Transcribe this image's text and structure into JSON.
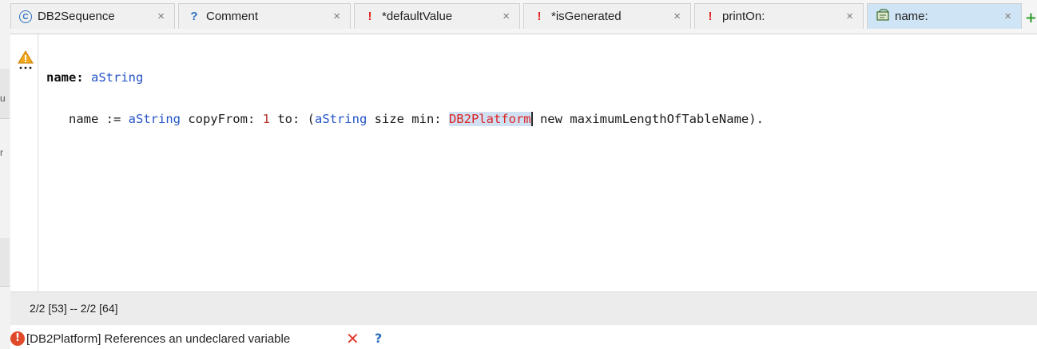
{
  "tabs": [
    {
      "icon": "class-icon",
      "glyph": "C",
      "label": "DB2Sequence",
      "active": false
    },
    {
      "icon": "question-icon",
      "glyph": "?",
      "label": "Comment",
      "active": false
    },
    {
      "icon": "exclamation-icon",
      "glyph": "!",
      "label": "*defaultValue",
      "active": false
    },
    {
      "icon": "exclamation-icon",
      "glyph": "!",
      "label": "*isGenerated",
      "active": false
    },
    {
      "icon": "exclamation-icon",
      "glyph": "!",
      "label": "printOn:",
      "active": false
    },
    {
      "icon": "method-icon",
      "glyph": "",
      "label": "name:",
      "active": true
    }
  ],
  "close_glyph": "×",
  "add_glyph": "+",
  "editor": {
    "line1": {
      "keyword": "name:",
      "arg": "aString"
    },
    "line2": {
      "indent": "   ",
      "t1": "name := ",
      "t2": "aString",
      "t3": " copyFrom: ",
      "t4": "1",
      "t5": " to: (",
      "t6": "aString",
      "t7": " size min: ",
      "t8": "DB2Platform",
      "t9": " new maximumLengthOfTableName)."
    },
    "gutter_marker": "warning-icon"
  },
  "status": {
    "position": "2/2 [53] -- 2/2 [64]"
  },
  "error": {
    "message": "[DB2Platform] References an undeclared variable",
    "dismiss": "✕",
    "help": "?",
    "color": "#e04a2a"
  },
  "left_strip": {
    "chars": [
      "u",
      "r"
    ]
  }
}
